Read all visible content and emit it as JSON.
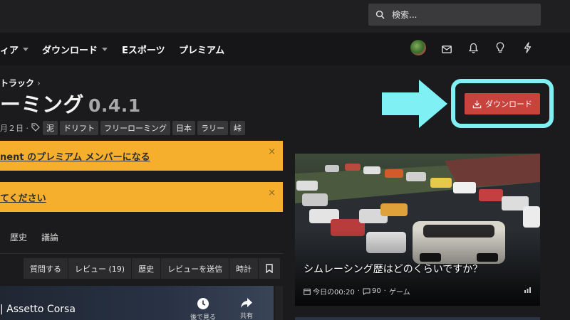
{
  "search": {
    "placeholder": "検索..."
  },
  "nav": {
    "items": [
      {
        "label": "ィア",
        "caret": true
      },
      {
        "label": "ダウンロード",
        "caret": true
      },
      {
        "label": "Eスポーツ",
        "caret": false
      },
      {
        "label": "プレミアム",
        "caret": false
      }
    ],
    "icons": [
      "avatar",
      "mail-icon",
      "bell-icon",
      "lightbulb-icon",
      "bolt-icon"
    ]
  },
  "breadcrumb": {
    "label": "トラック",
    "separator": "›"
  },
  "resource": {
    "title": "ーミング",
    "version": "0.4.1",
    "meta_date": "月２日 ·",
    "tags": [
      "泥",
      "ドリフト",
      "フリーローミング",
      "日本",
      "ラリー",
      "峠"
    ]
  },
  "download_button": {
    "label": "ダウンロード",
    "color": "#c8433c"
  },
  "highlight": {
    "color": "#7ff0f4"
  },
  "notices": [
    {
      "text": "nent のプレミアム メンバーになる",
      "close": "×"
    },
    {
      "text": "てください",
      "close": "×"
    }
  ],
  "tabs": [
    "歴史",
    "議論"
  ],
  "actions": [
    "質問する",
    "レビュー (19)",
    "歴史",
    "レビューを送信",
    "時計"
  ],
  "video": {
    "title": "| Assetto Corsa",
    "watch_later_label": "後で見る",
    "share_label": "共有"
  },
  "card": {
    "title": "シムレーシング歴はどのくらいですか？",
    "time": "今日の00:20",
    "comments": "90",
    "category": "ゲーム"
  }
}
